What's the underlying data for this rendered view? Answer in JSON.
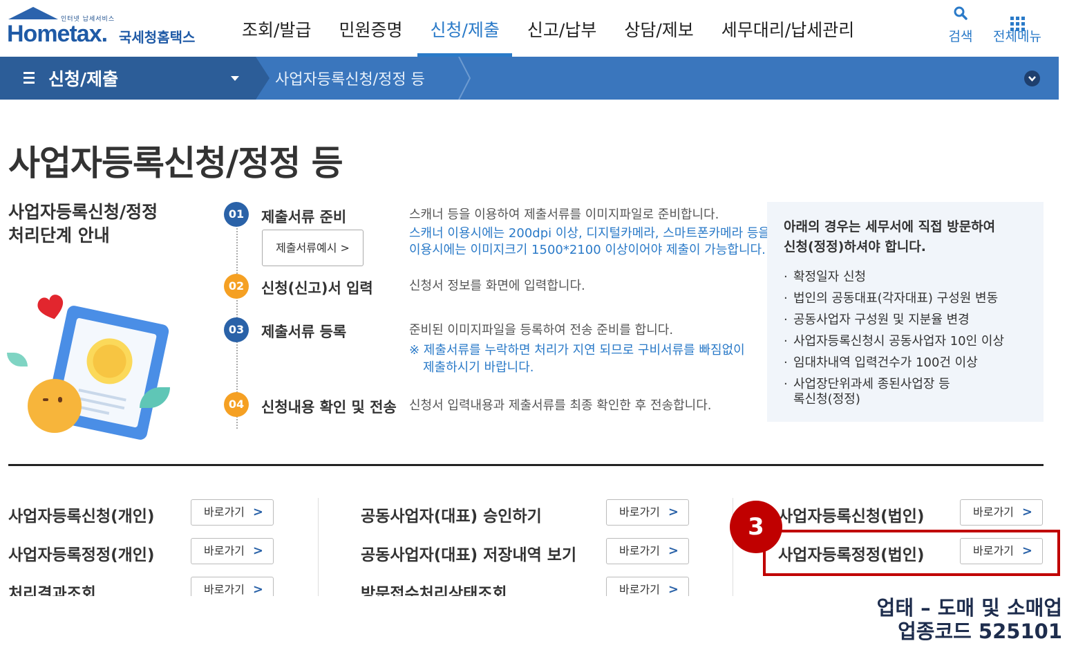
{
  "header": {
    "logo_small": "인터넷 납세서비스",
    "logo_main": "Hometax.",
    "logo_kr": "국세청홈택스",
    "nav": [
      "조회/발급",
      "민원증명",
      "신청/제출",
      "신고/납부",
      "상담/제보",
      "세무대리/납세관리"
    ],
    "active_nav": "신청/제출",
    "search_label": "검색",
    "allmenu_label": "전체메뉴"
  },
  "breadcrumb": {
    "category": "신청/제출",
    "current": "사업자등록신청/정정 등"
  },
  "page_title": "사업자등록신청/정정 등",
  "guide_title_1": "사업자등록신청/정정",
  "guide_title_2": "처리단계 안내",
  "steps": [
    {
      "num": "01",
      "title": "제출서류 준비",
      "desc": [
        "스캐너 등을 이용하여 제출서류를 이미지파일로 준비합니다."
      ],
      "note": [
        "스캐너 이용시에는 200dpi 이상, 디지털카메라, 스마트폰카메라 등을",
        "이용시에는 이미지크기 1500*2100 이상이어야 제출이 가능합니다."
      ],
      "button": "제출서류예시 >"
    },
    {
      "num": "02",
      "title": "신청(신고)서 입력",
      "desc": [
        "신청서 정보를 화면에 입력합니다."
      ]
    },
    {
      "num": "03",
      "title": "제출서류 등록",
      "desc": [
        "준비된 이미지파일을 등록하여 전송 준비를 합니다."
      ],
      "note": [
        "※ 제출서류를 누락하면 처리가 지연 되므로 구비서류를 빠짐없이",
        "제출하시기 바랍니다."
      ]
    },
    {
      "num": "04",
      "title": "신청내용 확인 및 전송",
      "desc": [
        "신청서 입력내용과 제출서류를 최종 확인한 후 전송합니다."
      ]
    }
  ],
  "notice": {
    "head_1": "아래의 경우는 세무서에 직접 방문하여",
    "head_2": "신청(정정)하셔야 합니다.",
    "items": [
      "확정일자 신청",
      "법인의 공동대표(각자대표) 구성원 변동",
      "공동사업자 구성원 및 지분율 변경",
      "사업자등록신청시 공동사업자 10인 이상",
      "임대차내역 입력건수가 100건 이상",
      "사업장단위과세 종된사업장 등록신청(정정)"
    ]
  },
  "links": {
    "go_label": "바로가기",
    "col1": [
      "사업자등록신청(개인)",
      "사업자등록정정(개인)",
      "처리결과조회"
    ],
    "col2": [
      "공동사업자(대표) 승인하기",
      "공동사업자(대표) 저장내역 보기",
      "방문접수처리상태조회"
    ],
    "col3": [
      "사업자등록신청(법인)",
      "사업자등록정정(법인)"
    ]
  },
  "annotation": {
    "step_number": "3",
    "line1": "업태 – 도매 및 소매업",
    "line2": "업종코드 525101"
  },
  "colors": {
    "accent": "#2a7ac8",
    "bar": "#3a76bd",
    "highlight": "#c00000"
  }
}
